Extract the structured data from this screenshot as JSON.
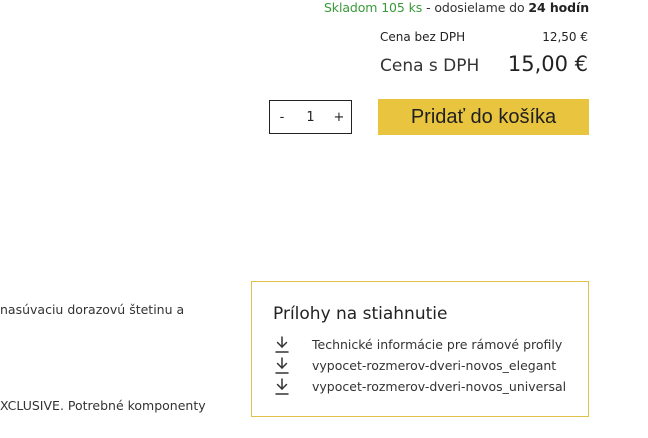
{
  "availability": {
    "stock_text": "Skladom 105 ks",
    "separator": " - ",
    "shipping_text": "odosielame do ",
    "shipping_time": "24 hodín"
  },
  "pricing": {
    "net_label": "Cena bez DPH",
    "net_value": "12,50 €",
    "gross_label": "Cena s DPH",
    "gross_value": "15,00 €"
  },
  "quantity": {
    "decrement": "-",
    "value": "1",
    "increment": "+"
  },
  "cart": {
    "add_label": "Pridať do košíka"
  },
  "description": {
    "line1": "nasúvaciu dorazovú štetinu a",
    "line2": "XCLUSIVE. Potrebné komponenty"
  },
  "attachments": {
    "title": "Prílohy na stiahnutie",
    "items": [
      {
        "label": "Technické informácie pre rámové profily",
        "icon": "download-icon"
      },
      {
        "label": "vypocet-rozmerov-dveri-novos_elegant",
        "icon": "download-icon"
      },
      {
        "label": "vypocet-rozmerov-dveri-novos_universal",
        "icon": "download-icon"
      }
    ]
  },
  "colors": {
    "in_stock": "#3a9a3a",
    "button_bg": "#e8c43f",
    "attachments_border": "#e0c24a"
  }
}
